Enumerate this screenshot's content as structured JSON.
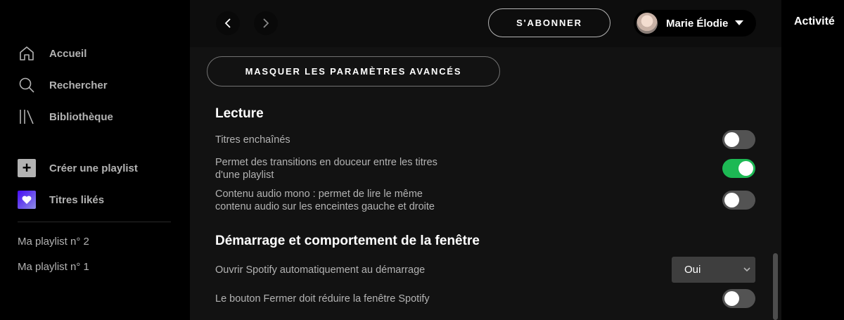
{
  "sidebar": {
    "nav": [
      {
        "label": "Accueil",
        "icon": "home-icon"
      },
      {
        "label": "Rechercher",
        "icon": "search-icon"
      },
      {
        "label": "Bibliothèque",
        "icon": "library-icon"
      }
    ],
    "actions": [
      {
        "label": "Créer une playlist",
        "icon": "plus-icon"
      },
      {
        "label": "Titres likés",
        "icon": "heart-icon"
      }
    ],
    "playlists": [
      "Ma playlist n° 2",
      "Ma playlist n° 1"
    ]
  },
  "topbar": {
    "subscribe_label": "S'ABONNER",
    "user_name": "Marie Élodie"
  },
  "right_panel": {
    "title": "Activité"
  },
  "settings": {
    "advanced_button": "MASQUER LES PARAMÈTRES AVANCÉS",
    "sections": [
      {
        "title": "Lecture",
        "items": [
          {
            "label": "Titres enchaînés",
            "type": "toggle",
            "on": false
          },
          {
            "label_lines": [
              "Permet des transitions en douceur entre les titres",
              "d'une playlist"
            ],
            "type": "toggle",
            "on": true
          },
          {
            "label_lines": [
              "Contenu audio mono : permet de lire le même",
              "contenu audio sur les enceintes gauche et droite"
            ],
            "type": "toggle",
            "on": false
          }
        ]
      },
      {
        "title": "Démarrage et comportement de la fenêtre",
        "items": [
          {
            "label": "Ouvrir Spotify automatiquement au démarrage",
            "type": "select",
            "value": "Oui"
          },
          {
            "label": "Le bouton Fermer doit réduire la fenêtre Spotify",
            "type": "toggle",
            "on": false
          }
        ]
      }
    ]
  },
  "colors": {
    "accent": "#1db954",
    "background": "#121212",
    "sidebar": "#000000",
    "muted_text": "#b3b3b3"
  }
}
